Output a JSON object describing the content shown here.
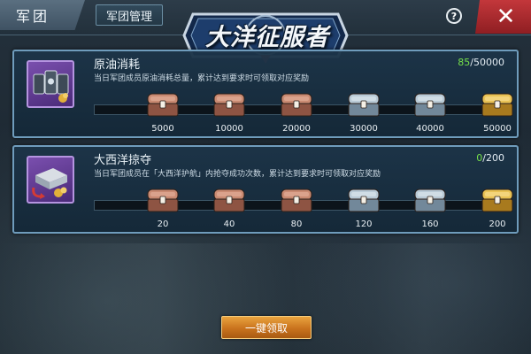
{
  "topbar": {
    "legion_tab": "军团",
    "manage_tab": "军团管理",
    "help": "?",
    "close": "✕"
  },
  "logo": {
    "title": "大洋征服者"
  },
  "tasks": [
    {
      "title": "原油消耗",
      "description": "当日军团成员原油消耗总量，累计达到要求时可领取对应奖励",
      "current": "85",
      "goal": "/50000",
      "icon": "oil-barrels-icon",
      "milestones": [
        "5000",
        "10000",
        "20000",
        "30000",
        "40000",
        "50000"
      ],
      "chest_tiers": [
        "bronze",
        "bronze",
        "bronze",
        "silver",
        "silver",
        "gold"
      ]
    },
    {
      "title": "大西洋掠夺",
      "description": "当日军团成员在「大西洋护航」内抢夺成功次数，累计达到要求时可领取对应奖励",
      "current": "0",
      "goal": "/200",
      "icon": "plunder-cargo-icon",
      "milestones": [
        "20",
        "40",
        "80",
        "120",
        "160",
        "200"
      ],
      "chest_tiers": [
        "bronze",
        "bronze",
        "bronze",
        "silver",
        "silver",
        "gold"
      ]
    }
  ],
  "footer": {
    "claim_all": "一键领取"
  },
  "colors": {
    "panel_border": "#6f9cbc",
    "progress_current": "#76e04a",
    "claim_button": "#c9731d",
    "close_button": "#b02a2e",
    "icon_frame": "#7a4fae"
  }
}
